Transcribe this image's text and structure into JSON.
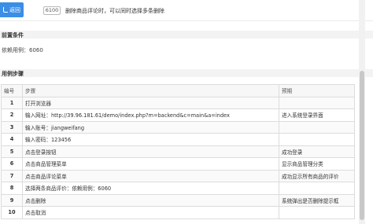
{
  "header": {
    "back_label": "返回",
    "case_id": "6100",
    "case_title": "删除商品评论时，可以同时选择多条删除"
  },
  "precondition": {
    "section_title": "前置条件",
    "text": "依赖用例：6060"
  },
  "steps": {
    "section_title": "用例步骤",
    "columns": [
      "编号",
      "步骤",
      "预期"
    ],
    "rows": [
      {
        "no": "1",
        "step": "打开浏览器",
        "expected": ""
      },
      {
        "no": "2",
        "step": "输入网址：http://39.96.181.61/demo/index.php?m=backend&c=main&a=index",
        "expected": "进入系统登录界面"
      },
      {
        "no": "3",
        "step": "输入账号：jiangweifang",
        "expected": ""
      },
      {
        "no": "4",
        "step": "输入密码：123456",
        "expected": ""
      },
      {
        "no": "5",
        "step": "点击登录按钮",
        "expected": "成功登录"
      },
      {
        "no": "6",
        "step": "点击商品管理菜单",
        "expected": "显示商品管理分类"
      },
      {
        "no": "7",
        "step": "点击商品评论菜单",
        "expected": "成功显示所有商品的评价"
      },
      {
        "no": "8",
        "step": "选择两条商品评价：依赖用例：6060",
        "expected": ""
      },
      {
        "no": "9",
        "step": "点击删除",
        "expected": "系统弹出是否删除提示框"
      },
      {
        "no": "10",
        "step": "点击取消",
        "expected": ""
      }
    ]
  },
  "colors": {
    "accent": "#3a8ee6",
    "section_bg": "#f3f3f3",
    "border": "#dcdcdc"
  },
  "icons": {
    "back": "back-arrow-icon"
  }
}
